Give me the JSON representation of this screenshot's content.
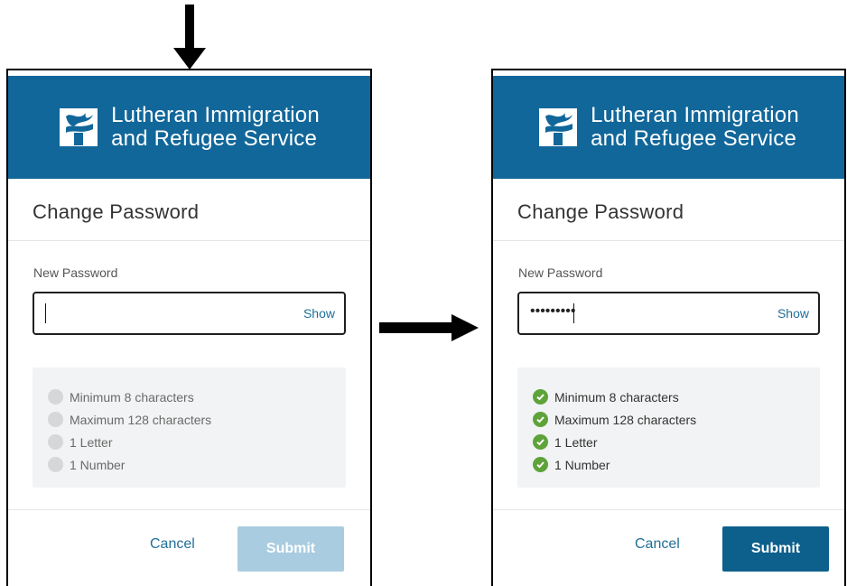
{
  "colors": {
    "brand_header": "#11679a",
    "link": "#1f6f99",
    "check_green": "#5ea33a",
    "submit_disabled": "#a9cce0",
    "submit_enabled": "#0d5f8c"
  },
  "brand": {
    "line1": "Lutheran Immigration",
    "line2": "and Refugee Service",
    "icon": "torch-logo-icon"
  },
  "before": {
    "title": "Change Password",
    "field_label": "New Password",
    "password_value": "",
    "show_label": "Show",
    "rules": [
      {
        "text": "Minimum 8 characters",
        "met": false
      },
      {
        "text": "Maximum 128 characters",
        "met": false
      },
      {
        "text": "1 Letter",
        "met": false
      },
      {
        "text": "1 Number",
        "met": false
      }
    ],
    "cancel_label": "Cancel",
    "submit_label": "Submit",
    "submit_enabled": false
  },
  "after": {
    "title": "Change Password",
    "field_label": "New Password",
    "password_value": "•••••••••",
    "show_label": "Show",
    "rules": [
      {
        "text": "Minimum 8 characters",
        "met": true
      },
      {
        "text": "Maximum 128 characters",
        "met": true
      },
      {
        "text": "1 Letter",
        "met": true
      },
      {
        "text": "1 Number",
        "met": true
      }
    ],
    "cancel_label": "Cancel",
    "submit_label": "Submit",
    "submit_enabled": true
  },
  "annotations": {
    "down_arrow_icon": "arrow-down-icon",
    "right_arrow_icon": "arrow-right-icon"
  }
}
